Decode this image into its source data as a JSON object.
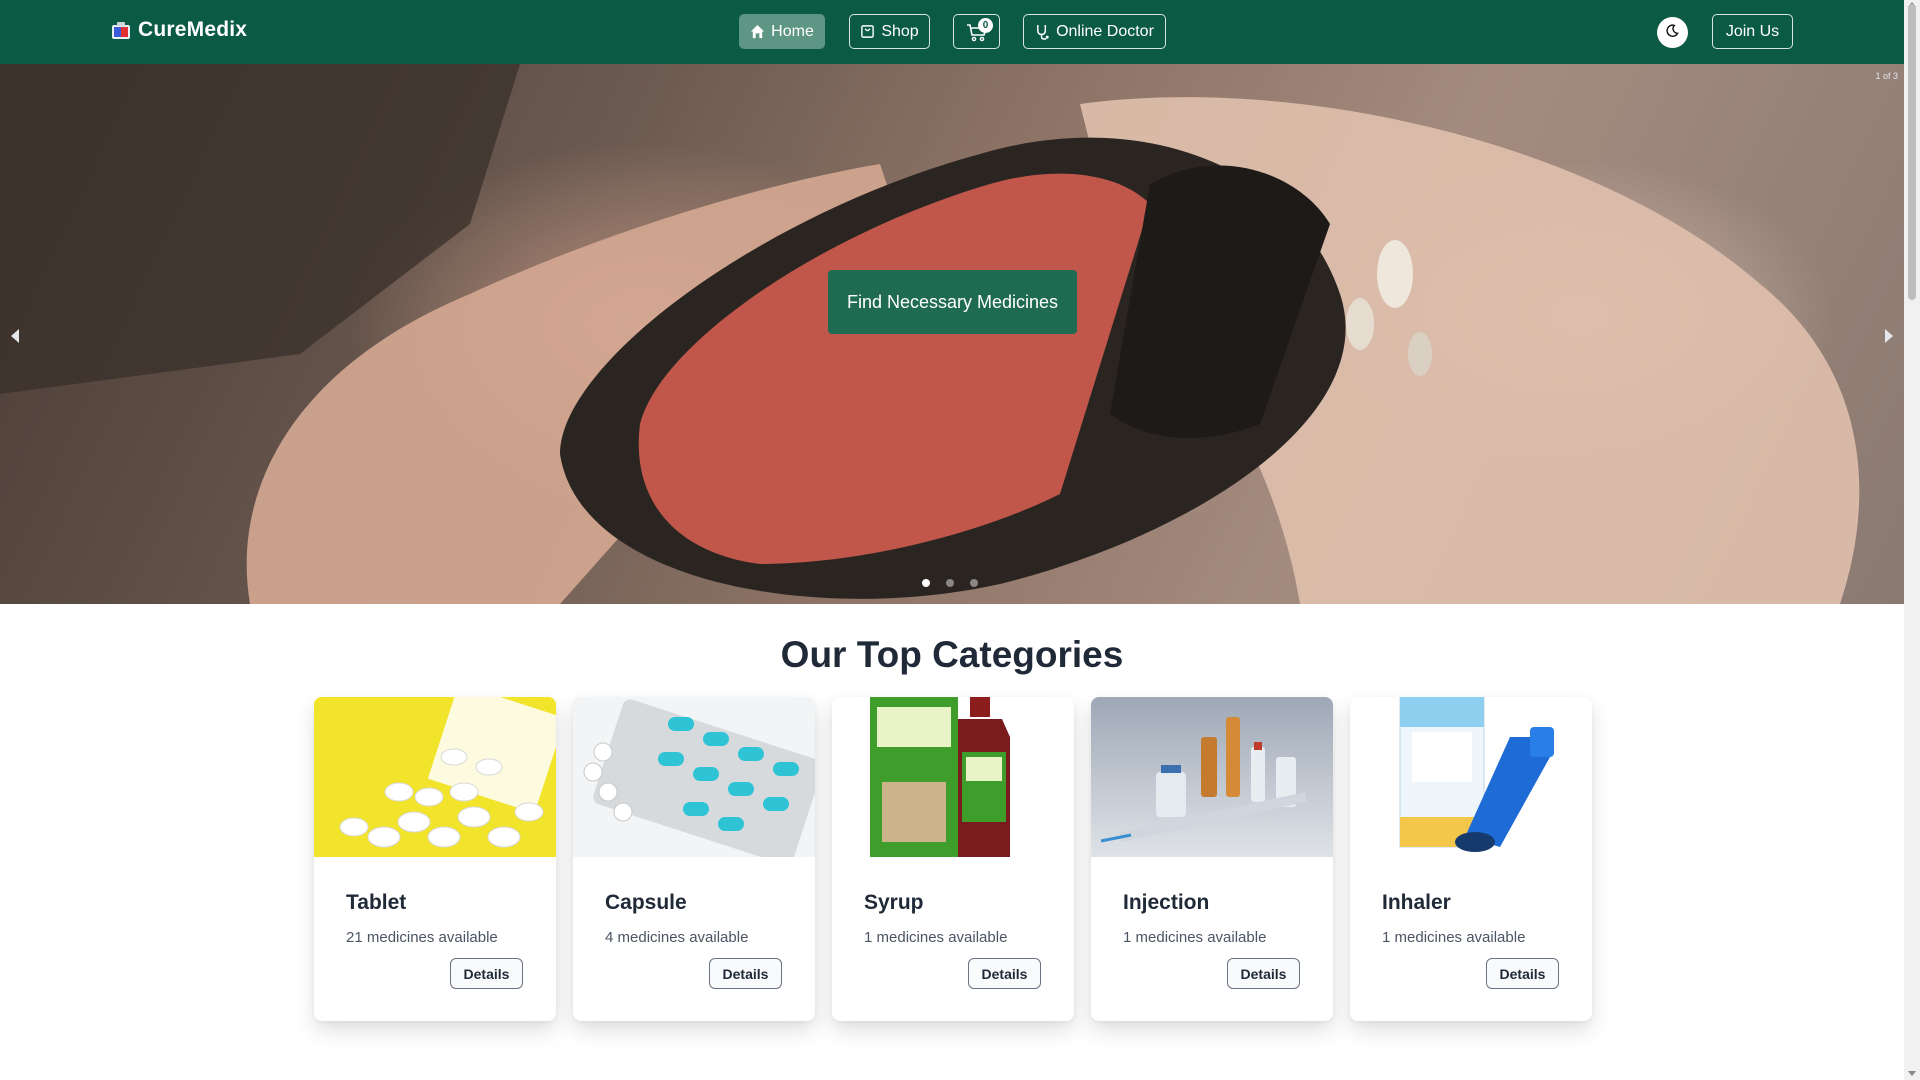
{
  "brand": {
    "name": "CureMedix"
  },
  "nav": {
    "home": "Home",
    "shop": "Shop",
    "cart_count": "0",
    "online_doctor": "Online Doctor",
    "join": "Join Us"
  },
  "hero": {
    "cta": "Find Necessary Medicines",
    "counter": "1 of 3",
    "active_slide": 1,
    "total_slides": 3
  },
  "categories": {
    "title": "Our Top Categories",
    "items": [
      {
        "name": "Tablet",
        "count": "21 medicines available",
        "button": "Details"
      },
      {
        "name": "Capsule",
        "count": "4 medicines available",
        "button": "Details"
      },
      {
        "name": "Syrup",
        "count": "1 medicines available",
        "button": "Details"
      },
      {
        "name": "Injection",
        "count": "1 medicines available",
        "button": "Details"
      },
      {
        "name": "Inhaler",
        "count": "1 medicines available",
        "button": "Details"
      }
    ]
  },
  "colors": {
    "primary": "#0b5a44",
    "active_nav": "#5d9684",
    "cta": "#1f6b52"
  }
}
